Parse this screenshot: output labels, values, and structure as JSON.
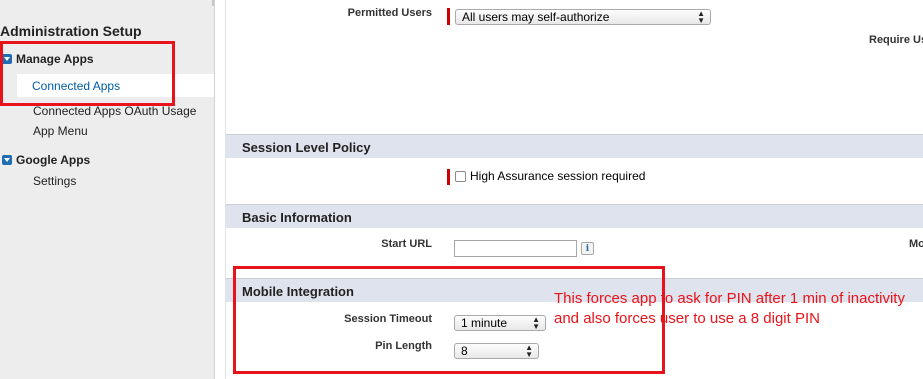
{
  "sidebar": {
    "title": "Administration Setup",
    "groups": [
      {
        "label": "Manage Apps",
        "items": [
          "Connected Apps",
          "Connected Apps OAuth Usage",
          "App Menu"
        ]
      },
      {
        "label": "Google Apps",
        "items": [
          "Settings"
        ]
      }
    ]
  },
  "form": {
    "permitted_users_label": "Permitted Users",
    "permitted_users_value": "All users may self-authorize",
    "right_cut_1": "Require Us",
    "session_section": "Session Level Policy",
    "high_assurance_label": "High Assurance session required",
    "basic_section": "Basic Information",
    "start_url_label": "Start URL",
    "start_url_value": "",
    "right_cut_2": "Mo",
    "info_glyph": "i",
    "mobile_section": "Mobile Integration",
    "session_timeout_label": "Session Timeout",
    "session_timeout_value": "1 minute",
    "pin_length_label": "Pin Length",
    "pin_length_value": "8"
  },
  "annotation": {
    "line1": "This forces app to ask for PIN after 1 min of inactivity",
    "line2": "and also forces user to use a 8 digit PIN",
    "color": "#e8141b"
  }
}
